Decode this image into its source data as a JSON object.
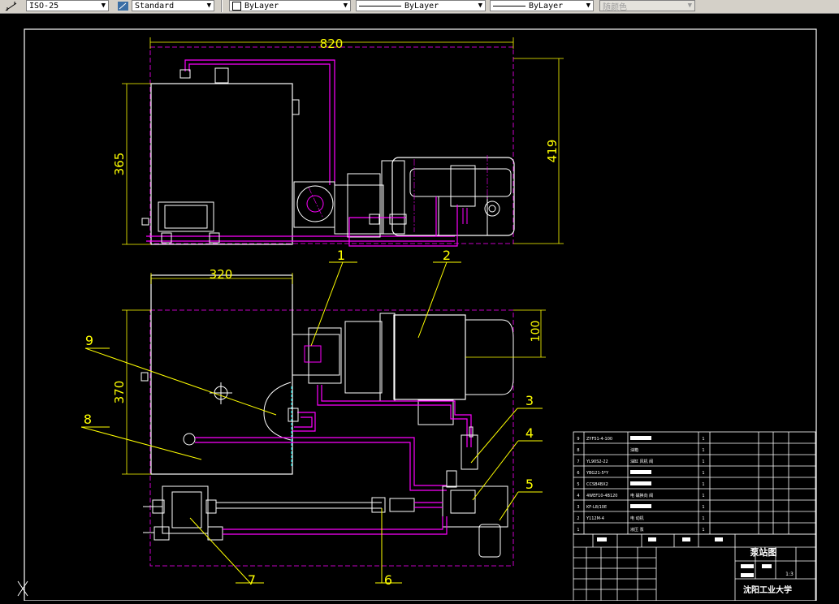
{
  "toolbar": {
    "dimstyle_value": "ISO-25",
    "textstyle_value": "Standard",
    "layer_value": "ByLayer",
    "linetype_value": "ByLayer",
    "lineweight_value": "ByLayer",
    "plotstyle_value": "随颜色"
  },
  "colors": {
    "dimension": "#ffff00",
    "geometry": "#ffffff",
    "piping": "#ff00ff",
    "frame": "#ffffff",
    "background": "#000000"
  },
  "drawing": {
    "top_view": {
      "width_dim": "820",
      "height_dim_left": "365",
      "height_dim_right": "419"
    },
    "front_view": {
      "width_dim": "320",
      "height_dim_left": "370",
      "height_dim_right": "100"
    },
    "balloons": [
      "1",
      "2",
      "3",
      "4",
      "5",
      "6",
      "7",
      "8",
      "9"
    ]
  },
  "title_block": {
    "drawing_name": "泵站图",
    "school": "沈阳工业大学",
    "scale": "1:3",
    "parts_rows": [
      {
        "no": "9",
        "code": "ZYF51-4-100",
        "name": "",
        "qty": "1"
      },
      {
        "no": "8",
        "code": "",
        "name": "油箱",
        "qty": "1"
      },
      {
        "no": "7",
        "code": "YL90S2-22",
        "name": "油缸 风机 阀",
        "qty": "1"
      },
      {
        "no": "6",
        "code": "YBG21-5*Y",
        "name": "",
        "qty": "1"
      },
      {
        "no": "5",
        "code": "CCSB4BX2",
        "name": "",
        "qty": "1"
      },
      {
        "no": "4",
        "code": "4WEF10-4B120",
        "name": "电 磁换向 阀",
        "qty": "1"
      },
      {
        "no": "3",
        "code": "KF-L8/10E",
        "name": "",
        "qty": "1"
      },
      {
        "no": "2",
        "code": "Y112M-4",
        "name": "电 动机",
        "qty": "1"
      },
      {
        "no": "1",
        "code": "",
        "name": "液压 泵",
        "qty": "1"
      }
    ]
  }
}
